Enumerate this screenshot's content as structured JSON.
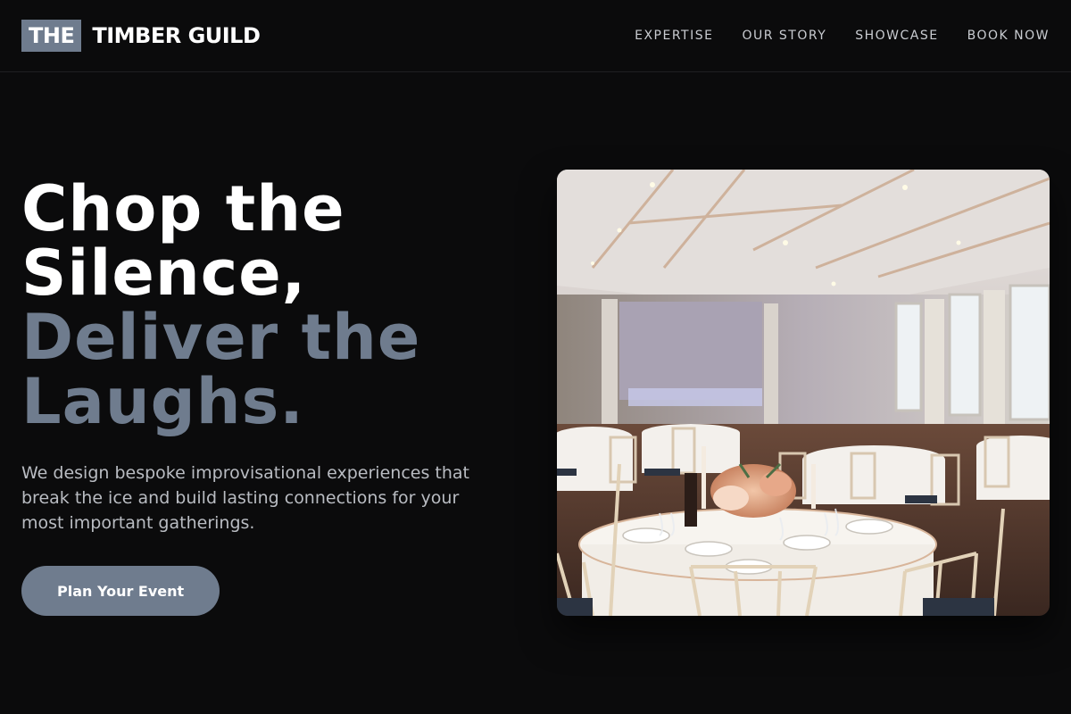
{
  "brand": {
    "mark": "THE",
    "name": "TIMBER GUILD"
  },
  "nav": {
    "items": [
      {
        "label": "EXPERTISE"
      },
      {
        "label": "OUR STORY"
      },
      {
        "label": "SHOWCASE"
      },
      {
        "label": "BOOK NOW"
      }
    ]
  },
  "hero": {
    "headline_primary": "Chop the Silence,",
    "headline_accent": "Deliver the Laughs.",
    "subtitle": "We design bespoke improvisational experiences that break the ice and build lasting connections for your most important gatherings.",
    "cta_label": "Plan Your Event"
  },
  "colors": {
    "background": "#0b0b0c",
    "accent": "#6f7c8e",
    "text": "#ffffff",
    "muted": "#b9bcc2"
  },
  "image": {
    "icon": "banquet-hall-photo"
  }
}
